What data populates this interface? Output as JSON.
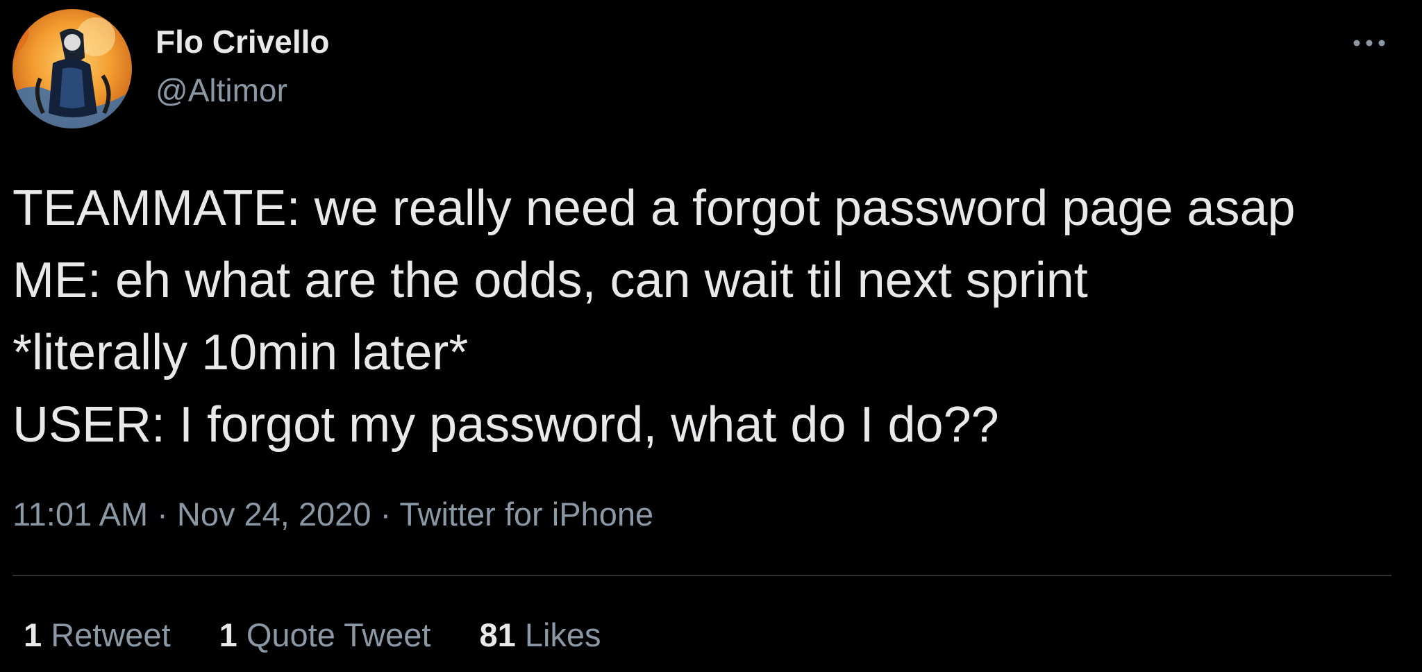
{
  "author": {
    "display_name": "Flo Crivello",
    "handle": "@Altimor",
    "avatar_icon": "avatar-portrait-orange"
  },
  "menu": {
    "icon": "more-options-icon"
  },
  "tweet": {
    "lines": [
      "TEAMMATE: we really need a forgot password page asap",
      "ME: eh what are the odds, can wait til next sprint",
      "*literally 10min later*",
      "USER: I forgot my password, what do I do??"
    ]
  },
  "meta": {
    "time": "11:01 AM",
    "separator": " · ",
    "date": "Nov 24, 2020",
    "source": "Twitter for iPhone"
  },
  "stats": {
    "retweets": {
      "count": "1",
      "label": "Retweet"
    },
    "quotes": {
      "count": "1",
      "label": "Quote Tweet"
    },
    "likes": {
      "count": "81",
      "label": "Likes"
    }
  },
  "colors": {
    "background": "#000000",
    "primary_text": "#e7e9ea",
    "secondary_text": "#8b98a5",
    "divider": "#2f3336",
    "avatar_accent": "#f39c2f"
  }
}
